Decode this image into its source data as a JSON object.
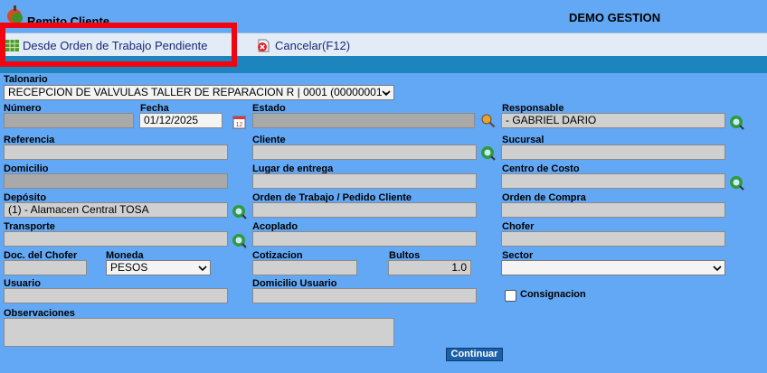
{
  "app": {
    "title": "Remito Cliente",
    "brand": "DEMO GESTION"
  },
  "toolbar": {
    "from_pending_label": "Desde Orden de Trabajo Pendiente",
    "cancel_label": "Cancelar(F12)"
  },
  "form": {
    "talonario": {
      "label": "Talonario",
      "value": "RECEPCION DE VALVULAS TALLER DE REPARACION R | 0001 (00000001 -"
    },
    "numero": {
      "label": "Número",
      "value": ""
    },
    "fecha": {
      "label": "Fecha",
      "value": "01/12/2025"
    },
    "estado": {
      "label": "Estado",
      "value": ""
    },
    "responsable": {
      "label": "Responsable",
      "value": "- GABRIEL DARIO"
    },
    "referencia": {
      "label": "Referencia",
      "value": ""
    },
    "cliente": {
      "label": "Cliente",
      "value": ""
    },
    "sucursal": {
      "label": "Sucursal",
      "value": ""
    },
    "domicilio": {
      "label": "Domicilio",
      "value": ""
    },
    "lugar_entrega": {
      "label": "Lugar de entrega",
      "value": ""
    },
    "centro_costo": {
      "label": "Centro de Costo",
      "value": ""
    },
    "deposito": {
      "label": "Depósito",
      "value": "(1) - Alamacen Central TOSA"
    },
    "orden_trabajo": {
      "label": "Orden de Trabajo / Pedido Cliente",
      "value": ""
    },
    "orden_compra": {
      "label": "Orden de Compra",
      "value": ""
    },
    "transporte": {
      "label": "Transporte",
      "value": ""
    },
    "acoplado": {
      "label": "Acoplado",
      "value": ""
    },
    "chofer": {
      "label": "Chofer",
      "value": ""
    },
    "doc_chofer": {
      "label": "Doc. del Chofer",
      "value": ""
    },
    "moneda": {
      "label": "Moneda",
      "value": "PESOS"
    },
    "cotizacion": {
      "label": "Cotizacion",
      "value": ""
    },
    "bultos": {
      "label": "Bultos",
      "value": "1.0"
    },
    "sector": {
      "label": "Sector",
      "value": ""
    },
    "usuario": {
      "label": "Usuario",
      "value": ""
    },
    "domicilio_usuario": {
      "label": "Domicilio Usuario",
      "value": ""
    },
    "consignacion": {
      "label": "Consignacion",
      "checked": false
    },
    "observaciones": {
      "label": "Observaciones",
      "value": ""
    }
  },
  "actions": {
    "continue_label": "Continuar"
  },
  "colors": {
    "page_bg": "#63a8f4",
    "toolbar_bg": "#e3ecf6",
    "band": "#1d84be",
    "highlight": "#f00510",
    "field_bg": "#d0d0d0"
  }
}
